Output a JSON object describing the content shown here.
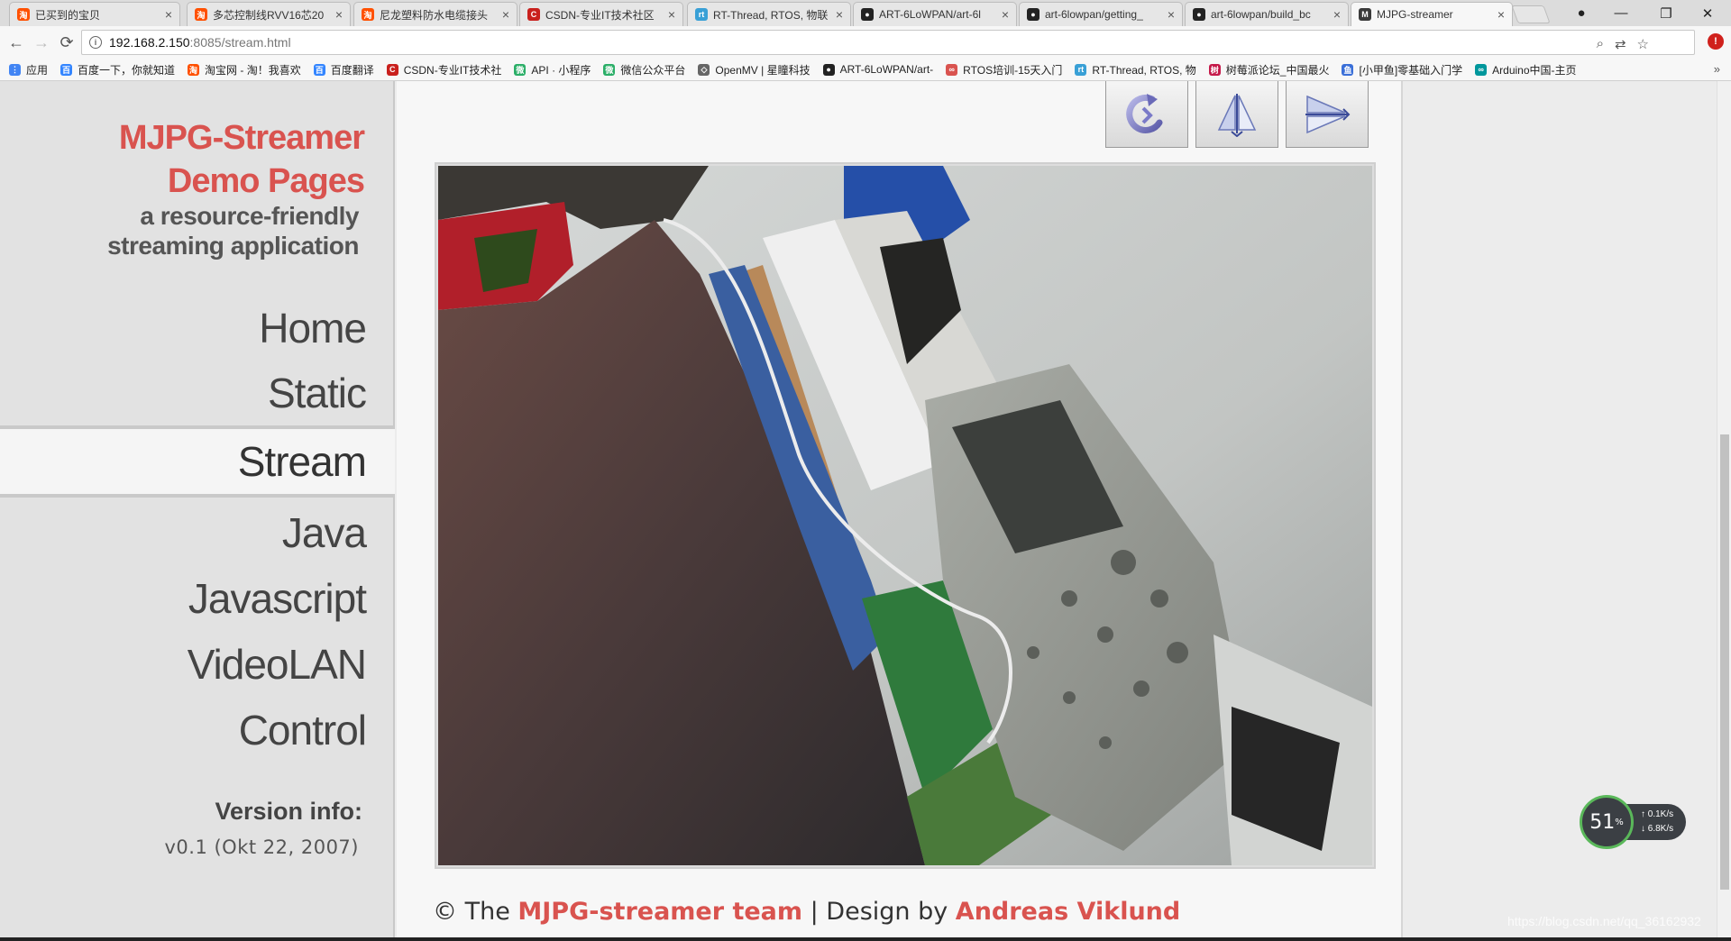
{
  "browser": {
    "tabs": [
      {
        "title": "已买到的宝贝",
        "favicon": "taobao-icon",
        "color": "#ff5000",
        "glyph": "淘"
      },
      {
        "title": "多芯控制线RVV16芯20",
        "favicon": "taobao-icon",
        "color": "#ff5000",
        "glyph": "淘"
      },
      {
        "title": "尼龙塑料防水电缆接头",
        "favicon": "taobao-icon",
        "color": "#ff5000",
        "glyph": "淘"
      },
      {
        "title": "CSDN-专业IT技术社区",
        "favicon": "csdn-icon",
        "color": "#c9201d",
        "glyph": "C"
      },
      {
        "title": "RT-Thread, RTOS, 物联",
        "favicon": "rtthread-icon",
        "color": "#39a0d6",
        "glyph": "rt"
      },
      {
        "title": "ART-6LoWPAN/art-6l",
        "favicon": "github-icon",
        "color": "#222222",
        "glyph": "●"
      },
      {
        "title": "art-6lowpan/getting_",
        "favicon": "github-icon",
        "color": "#222222",
        "glyph": "●"
      },
      {
        "title": "art-6lowpan/build_bc",
        "favicon": "github-icon",
        "color": "#222222",
        "glyph": "●"
      },
      {
        "title": "MJPG-streamer",
        "favicon": "mjpg-icon",
        "color": "#3a3a3a",
        "glyph": "M"
      }
    ],
    "close_glyph": "×",
    "address": {
      "host": "192.168.2.150",
      "path": ":8085/stream.html"
    },
    "window_controls": {
      "profile": "●",
      "minimize": "—",
      "restore": "❐",
      "close": "✕"
    },
    "nav_glyphs": {
      "back": "←",
      "forward": "→",
      "reload": "⟳",
      "info": "i"
    },
    "omni_icons": {
      "zoom": "⌕",
      "translate": "⇄",
      "star": "☆"
    },
    "ext_glyph": "!",
    "bookmarks": [
      {
        "label": "应用",
        "color": "#4285f4",
        "glyph": "⋮"
      },
      {
        "label": "百度一下，你就知道",
        "color": "#3385ff",
        "glyph": "百"
      },
      {
        "label": "淘宝网 - 淘！我喜欢",
        "color": "#ff5000",
        "glyph": "淘"
      },
      {
        "label": "百度翻译",
        "color": "#3385ff",
        "glyph": "百"
      },
      {
        "label": "CSDN-专业IT技术社",
        "color": "#c9201d",
        "glyph": "C"
      },
      {
        "label": "API · 小程序",
        "color": "#2aae67",
        "glyph": "微"
      },
      {
        "label": "微信公众平台",
        "color": "#2aae67",
        "glyph": "微"
      },
      {
        "label": "OpenMV | 星瞳科技",
        "color": "#666666",
        "glyph": "◇"
      },
      {
        "label": "ART-6LoWPAN/art-",
        "color": "#222222",
        "glyph": "●"
      },
      {
        "label": "RTOS培训-15天入门",
        "color": "#d9534f",
        "glyph": "∞"
      },
      {
        "label": "RT-Thread, RTOS, 物",
        "color": "#39a0d6",
        "glyph": "rt"
      },
      {
        "label": "树莓派论坛_中国最火",
        "color": "#c51a4a",
        "glyph": "树"
      },
      {
        "label": "[小甲鱼]零基础入门学",
        "color": "#3a6fd8",
        "glyph": "鱼"
      },
      {
        "label": "Arduino中国-主页",
        "color": "#00979c",
        "glyph": "∞"
      }
    ],
    "bookmarks_more": "»"
  },
  "sidebar": {
    "logo_line1": "MJPG-Streamer",
    "logo_line2": "Demo Pages",
    "tagline1": "a resource-friendly",
    "tagline2": "streaming application",
    "nav": [
      {
        "label": "Home",
        "active": false
      },
      {
        "label": "Static",
        "active": false
      },
      {
        "label": "Stream",
        "active": true
      },
      {
        "label": "Java",
        "active": false
      },
      {
        "label": "Javascript",
        "active": false
      },
      {
        "label": "VideoLAN",
        "active": false
      },
      {
        "label": "Control",
        "active": false
      }
    ],
    "version_label": "Version info:",
    "version_value": "v0.1 (Okt 22, 2007)"
  },
  "controls": [
    {
      "name": "rotate-button",
      "icon": "rotate-icon"
    },
    {
      "name": "mirror-vertical-button",
      "icon": "mirror-vertical-icon"
    },
    {
      "name": "mirror-horizontal-button",
      "icon": "mirror-horizontal-icon"
    }
  ],
  "footer": {
    "prefix": "© The ",
    "team": "MJPG-streamer team",
    "sep": " | Design by ",
    "designer": "Andreas Viklund"
  },
  "speed_widget": {
    "percent": "51",
    "unit": "%",
    "up": "↑ 0.1K/s",
    "down": "↓ 6.8K/s"
  },
  "watermark": "https://blog.csdn.net/qq_36162932",
  "colors": {
    "accent": "#d9534f",
    "sidebar_bg": "#e2e2e2",
    "content_bg": "#f7f7f7"
  }
}
